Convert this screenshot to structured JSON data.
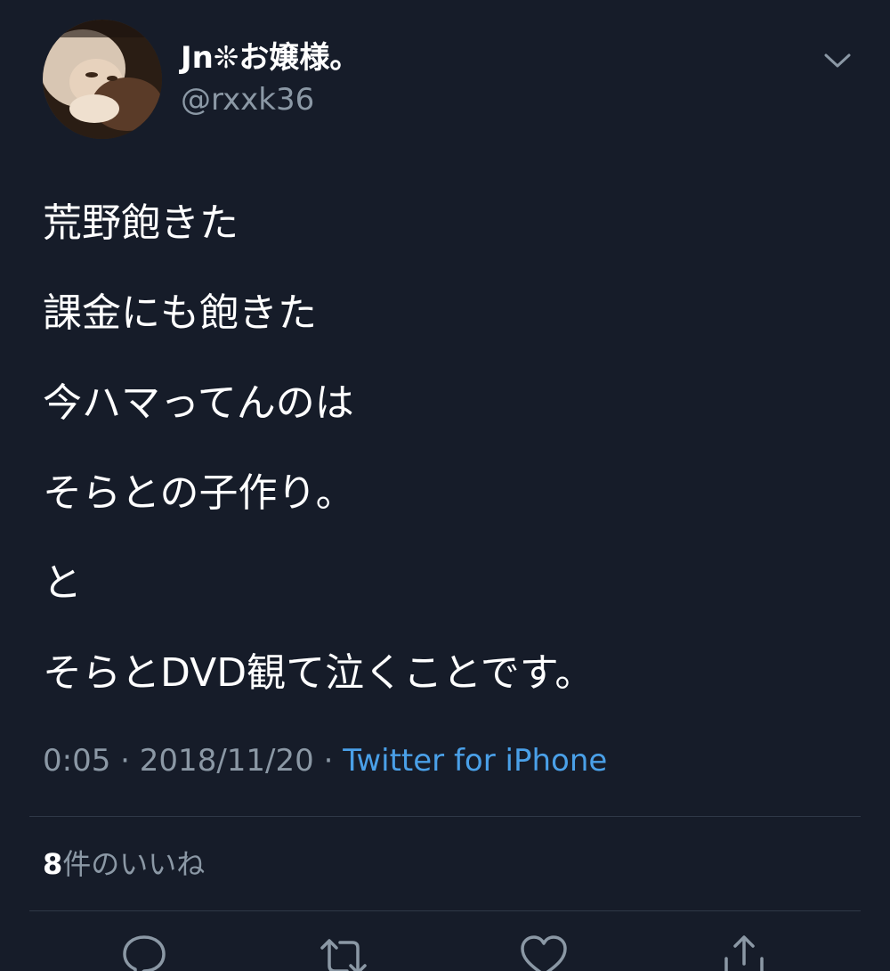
{
  "tweet": {
    "display_name": "Jn❊お嬢様。",
    "handle": "@rxxk36",
    "lines": [
      "荒野飽きた",
      "課金にも飽きた",
      "今ハマってんのは",
      "そらとの子作り。",
      "と",
      "そらとDVD観て泣くことです。"
    ],
    "time": "0:05",
    "separator": " · ",
    "date": "2018/11/20",
    "source": "Twitter for iPhone"
  },
  "likes": {
    "count": "8",
    "label": "件のいいね"
  },
  "icons": {
    "caret": "chevron-down-icon",
    "reply": "reply-icon",
    "retweet": "retweet-icon",
    "like": "heart-icon",
    "share": "share-icon"
  },
  "colors": {
    "background": "#161c29",
    "primary_text": "#ffffff",
    "secondary_text": "#8b98a5",
    "link": "#4aa0e8"
  }
}
